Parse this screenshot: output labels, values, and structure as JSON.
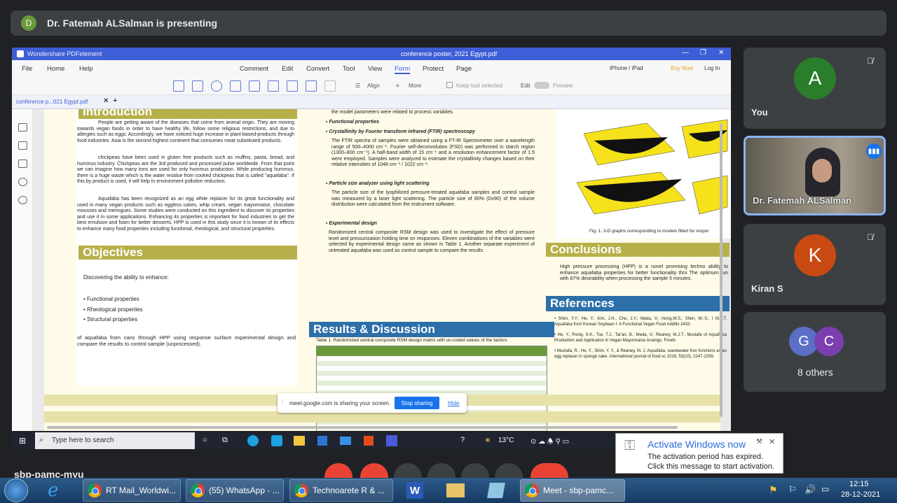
{
  "banner": {
    "initial": "D",
    "text": "Dr. Fatemah ALSalman is presenting"
  },
  "pdf": {
    "app_title": "Wondershare PDFelement",
    "doc_title": "conference poster, 2021 Egypt.pdf",
    "menus": [
      "File",
      "Home",
      "Help",
      "Comment",
      "Edit",
      "Convert",
      "Tool",
      "View",
      "Form",
      "Protect",
      "Page"
    ],
    "right_menu": {
      "device": "iPhone / iPad",
      "buy": "Buy Now",
      "login": "Log In"
    },
    "toolbar": {
      "align": "Align",
      "more": "More",
      "keep": "Keep tool selected",
      "edit": "Edit",
      "preview": "Preview"
    },
    "tab": "conference  p...021 Egypt.pdf"
  },
  "poster": {
    "introduction": "Introduction",
    "intro_p1": "People are getting aware of the diseases that come from animal origin. They are moving towards vegan foods in order to have healthy life, follow some religious restrictions, and due to allergies such as eggs. Accordingly, we have noticed huge increase in plant-based-products through food industries. Asia is the second highest continent that consumes meat substituted products.",
    "intro_p2": "chickpeas have been used in gluten free products such as muffins, pasta, bread, and hummus industry. Chickpeas are the 3rd produced and processed pulse worldwide. From that point we can imagine how many tons are used for only hummus production. While producing hummus, there is a huge waste which is the water residue from cooked chickpeas that is called \"aquafaba\". If this by product is used, it will help in environment pollution reduction.",
    "intro_p3": "Aquafaba has been recognized as an egg white replacer for its great functionality and used in many vegan products such as eggless cakes, whip cream, vegan mayonnaise, chocolate mousses and meringues. Some studies were conducted on this ingredient to discover its properties and use it in some applications. Enhancing its properties is important for food industries to get the best emulsion and foam for better desserts. HPP is used in this study since it is known of its effects to enhance many food properties including functional, rheological, and structural properties.",
    "objectives": "Objectives",
    "obj_intro": "Discovering the ability to enhance:",
    "obj_items": [
      "Functional properties",
      "Rheological properties",
      "Structural properties"
    ],
    "obj_end": "of aquafaba from cans through HPP using response surface experimental design and compare the results to control sample (unprocessed).",
    "mid_top": "the model parameters were related to process variables.",
    "func": "Functional properties",
    "ftir_h": "Crystallinity by Fourier transform infrared (FTIR) spectroscopy",
    "ftir": "The FTIR spectra of samples were obtained using a FT-IR Spectrometer over a wavelength range of 500–4000 cm⁻¹. Fourier self-deconvolution (FSD) was performed in starch region (1300–800 cm⁻¹). A half-band width of 15 cm⁻¹ and a resolution enhancement factor of 1.5 were employed. Samples were analyzed to estimate the crystallinity changes based on their relative intensities of 1048 cm⁻¹ / 1022 cm⁻¹.",
    "psa_h": "Particle size analyzer using light scattering",
    "psa": "The particle size of the lyophilized pressure-treated aquafaba samples and control sample was measured by a laser light scattering. The particle size of 90% (Dv90) of the volume distribution were calculated from the instrument software.",
    "exp_h": "Experimental design",
    "exp": "Randomized central composite RSM design was used to investigate the effect of pressure level and pressurization holding time on responses. Eleven combinations of the variables were selected by experimental design same as shown in Table 1. Another separate experiment of untreated aquafaba was used as control sample to compare the results",
    "results": "Results & Discussion",
    "table_caption": "Table 1. Randomized central composite RSM design matrix with un-coded values of the factors",
    "fig_caption": "Fig. 1. 3-D graphs corresponding to models fitted for respor",
    "conclusions": "Conclusions",
    "concl": "High pressure processing (HPP) is a novel promising techno ability to enhance aquafaba properties for better functionality thro The optimum run with 87% desirability when processing the sample 5 minutes.",
    "references": "References",
    "refs": [
      "Shim, Y.Y.; He, Y.; Kim, J.H.; Cho, J.Y.; Meda, V.; Hong,W.S.; Shim, W.-S.; I M.J.T. Aquafaba from Korean Soybean I: A Functional Vegan Food Additiv 2433.",
      "He, Y.; Purdy, S.K.; Tse, T.J.; Tar'an, B.; Meda, V.; Reaney, M.J.T.; Mustafa of Aquafaba Production and Application in Vegan Mayonnaise Analogs. Foods",
      "Mustafa, R., He, Y., Shim, Y. Y., & Reaney, M. J. Aquafaba, wastewater fron functions as an egg replacer in sponge cake. International journal of food sc 2018, 53(10), 2247-2256."
    ]
  },
  "share": {
    "text": "meet.google.com is sharing your screen.",
    "stop": "Stop sharing",
    "hide": "Hide"
  },
  "remote_taskbar": {
    "search": "Type here to search",
    "temp": "13°C"
  },
  "tiles": [
    {
      "initial": "A",
      "name": "You",
      "color": "#2a7d2a"
    },
    {
      "name": "Dr. Fatemah ALSalman"
    },
    {
      "initial": "K",
      "name": "Kiran S",
      "color": "#c84a12"
    },
    {
      "a": "G",
      "b": "C",
      "name": "8 others",
      "ca": "#5b6fc7",
      "cb": "#7b3fb0"
    }
  ],
  "activation": {
    "title": "Activate Windows now",
    "l1": "The activation period has expired.",
    "l2": "Click this message to start activation."
  },
  "meeting_code": "sbp-pamc-myu",
  "taskbar": {
    "items": [
      "RT Mail_Worldwi...",
      "(55) WhatsApp - ...",
      "Technoarete R & ...",
      "Meet - sbp-pamc..."
    ],
    "time": "12:15",
    "date": "28-12-2021"
  }
}
